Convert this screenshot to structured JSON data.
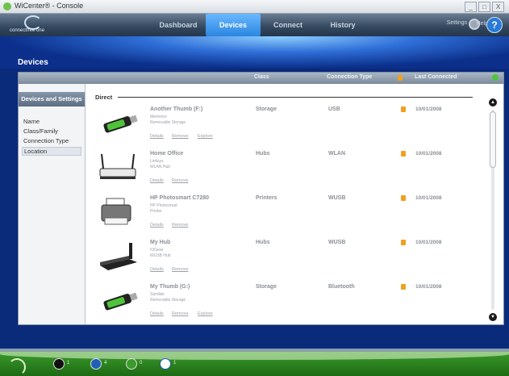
{
  "window": {
    "title": "WiCenter® - Console",
    "buttons": [
      "_",
      "□",
      "X"
    ]
  },
  "brand": {
    "name": "connectfree one"
  },
  "nav": {
    "tabs": [
      "Dashboard",
      "Devices",
      "Connect",
      "History"
    ],
    "active": "Devices",
    "settings": "Settings",
    "help": "Help"
  },
  "section": {
    "title": "Devices"
  },
  "columns": {
    "class": "Class",
    "connection_type": "Connection Type",
    "last_connected": "Last Connected"
  },
  "sidebar": {
    "header": "Devices and Settings",
    "items": [
      "Name",
      "Class/Family",
      "Connection Type",
      "Location"
    ],
    "selected": "Location"
  },
  "group": {
    "label": "Direct"
  },
  "links": {
    "details": "Details",
    "remove": "Remove",
    "explore": "Explore"
  },
  "devices": [
    {
      "name": "Another Thumb (F:)",
      "sub1": "Memorex",
      "sub2": "Removable Storage",
      "class": "Storage",
      "connection": "USB",
      "last": "10/01/2008",
      "icon": "usb-drive-icon",
      "explore": true
    },
    {
      "name": "Home Office",
      "sub1": "Linksys",
      "sub2": "WLAN Hub",
      "class": "Hubs",
      "connection": "WLAN",
      "last": "10/01/2008",
      "icon": "router-icon",
      "explore": false
    },
    {
      "name": "HP Photosmart C7280",
      "sub1": "HP Photosmart",
      "sub2": "Printer",
      "class": "Printers",
      "connection": "WUSB",
      "last": "10/01/2008",
      "icon": "printer-icon",
      "explore": false
    },
    {
      "name": "My Hub",
      "sub1": "IOGear",
      "sub2": "WUSB Hub",
      "class": "Hubs",
      "connection": "WUSB",
      "last": "10/01/2008",
      "icon": "wusb-hub-icon",
      "explore": false
    },
    {
      "name": "My Thumb (G:)",
      "sub1": "Sandisk",
      "sub2": "Removable Storage",
      "class": "Storage",
      "connection": "Bluetooth",
      "last": "10/01/2008",
      "icon": "usb-drive-icon",
      "explore": true
    }
  ],
  "statusbar": {
    "items": [
      {
        "icon": "wlan-icon",
        "count": "1"
      },
      {
        "icon": "wusb-icon",
        "count": "4"
      },
      {
        "icon": "wired-icon",
        "count": "0"
      },
      {
        "icon": "bluetooth-icon",
        "count": "1"
      }
    ]
  },
  "colors": {
    "accent": "#2a86e0",
    "status_green": "#3a9b2a",
    "lock": "#f0a020"
  }
}
